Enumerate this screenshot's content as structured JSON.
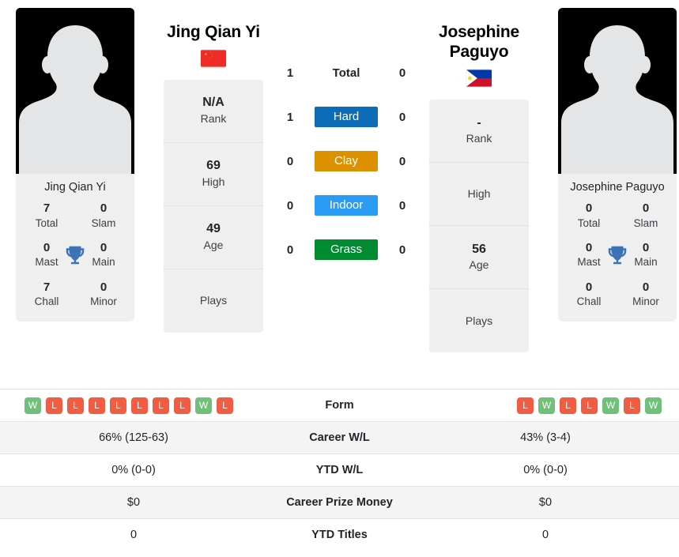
{
  "players": {
    "left": {
      "name": "Jing Qian Yi",
      "card_name": "Jing Qian Yi",
      "flag": "china-flag",
      "titles": {
        "total_value": "7",
        "total_label": "Total",
        "slam_value": "0",
        "slam_label": "Slam",
        "mast_value": "0",
        "mast_label": "Mast",
        "main_value": "0",
        "main_label": "Main",
        "chall_value": "7",
        "chall_label": "Chall",
        "minor_value": "0",
        "minor_label": "Minor"
      },
      "attrs": [
        {
          "value": "N/A",
          "label": "Rank"
        },
        {
          "value": "69",
          "label": "High"
        },
        {
          "value": "49",
          "label": "Age"
        },
        {
          "value": "",
          "label": "Plays"
        }
      ],
      "form": [
        "W",
        "L",
        "L",
        "L",
        "L",
        "L",
        "L",
        "L",
        "W",
        "L"
      ],
      "career_wl": "66% (125-63)",
      "ytd_wl": "0% (0-0)",
      "career_prize_money": "$0",
      "ytd_titles": "0"
    },
    "right": {
      "name": "Josephine Paguyo",
      "card_name": "Josephine Paguyo",
      "flag": "philippines-flag",
      "titles": {
        "total_value": "0",
        "total_label": "Total",
        "slam_value": "0",
        "slam_label": "Slam",
        "mast_value": "0",
        "mast_label": "Mast",
        "main_value": "0",
        "main_label": "Main",
        "chall_value": "0",
        "chall_label": "Chall",
        "minor_value": "0",
        "minor_label": "Minor"
      },
      "attrs": [
        {
          "value": "-",
          "label": "Rank"
        },
        {
          "value": "",
          "label": "High"
        },
        {
          "value": "56",
          "label": "Age"
        },
        {
          "value": "",
          "label": "Plays"
        }
      ],
      "form": [
        "L",
        "W",
        "L",
        "L",
        "W",
        "L",
        "W"
      ],
      "career_wl": "43% (3-4)",
      "ytd_wl": "0% (0-0)",
      "career_prize_money": "$0",
      "ytd_titles": "0"
    }
  },
  "head_to_head": [
    {
      "left": "1",
      "label": "Total",
      "right": "0",
      "badge": false,
      "color": ""
    },
    {
      "left": "1",
      "label": "Hard",
      "right": "0",
      "badge": true,
      "color": "#0c6cb8"
    },
    {
      "left": "0",
      "label": "Clay",
      "right": "0",
      "badge": true,
      "color": "#dd9100"
    },
    {
      "left": "0",
      "label": "Indoor",
      "right": "0",
      "badge": true,
      "color": "#2b9cf5"
    },
    {
      "left": "0",
      "label": "Grass",
      "right": "0",
      "badge": true,
      "color": "#008b31"
    }
  ],
  "table_rows": [
    {
      "key": "form",
      "label": "Form"
    },
    {
      "key": "career_wl",
      "label": "Career W/L"
    },
    {
      "key": "ytd_wl",
      "label": "YTD W/L"
    },
    {
      "key": "career_prize_money",
      "label": "Career Prize Money"
    },
    {
      "key": "ytd_titles",
      "label": "YTD Titles"
    }
  ],
  "colors": {
    "win_badge": "#6fc079",
    "loss_badge": "#f15c42",
    "trophy": "#3d72b4",
    "panel_bg": "#efefef",
    "row_alt_bg": "#f4f4f4"
  }
}
